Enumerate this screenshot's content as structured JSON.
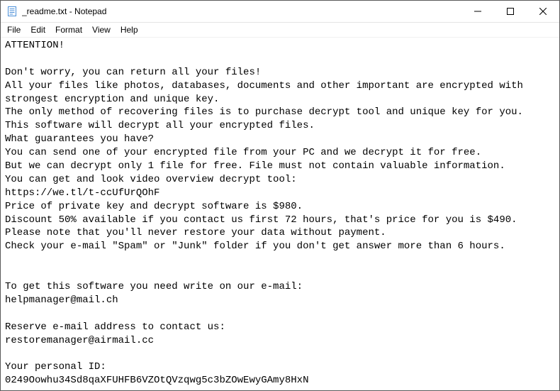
{
  "window": {
    "title": "_readme.txt - Notepad"
  },
  "menu": {
    "file": "File",
    "edit": "Edit",
    "format": "Format",
    "view": "View",
    "help": "Help"
  },
  "document": {
    "lines": [
      "ATTENTION!",
      "",
      "Don't worry, you can return all your files!",
      "All your files like photos, databases, documents and other important are encrypted with strongest encryption and unique key.",
      "The only method of recovering files is to purchase decrypt tool and unique key for you.",
      "This software will decrypt all your encrypted files.",
      "What guarantees you have?",
      "You can send one of your encrypted file from your PC and we decrypt it for free.",
      "But we can decrypt only 1 file for free. File must not contain valuable information.",
      "You can get and look video overview decrypt tool:",
      "https://we.tl/t-ccUfUrQOhF",
      "Price of private key and decrypt software is $980.",
      "Discount 50% available if you contact us first 72 hours, that's price for you is $490.",
      "Please note that you'll never restore your data without payment.",
      "Check your e-mail \"Spam\" or \"Junk\" folder if you don't get answer more than 6 hours.",
      "",
      "",
      "To get this software you need write on our e-mail:",
      "helpmanager@mail.ch",
      "",
      "Reserve e-mail address to contact us:",
      "restoremanager@airmail.cc",
      "",
      "Your personal ID:",
      "0249Oowhu34Sd8qaXFUHFB6VZOtQVzqwg5c3bZOwEwyGAmy8HxN"
    ]
  }
}
